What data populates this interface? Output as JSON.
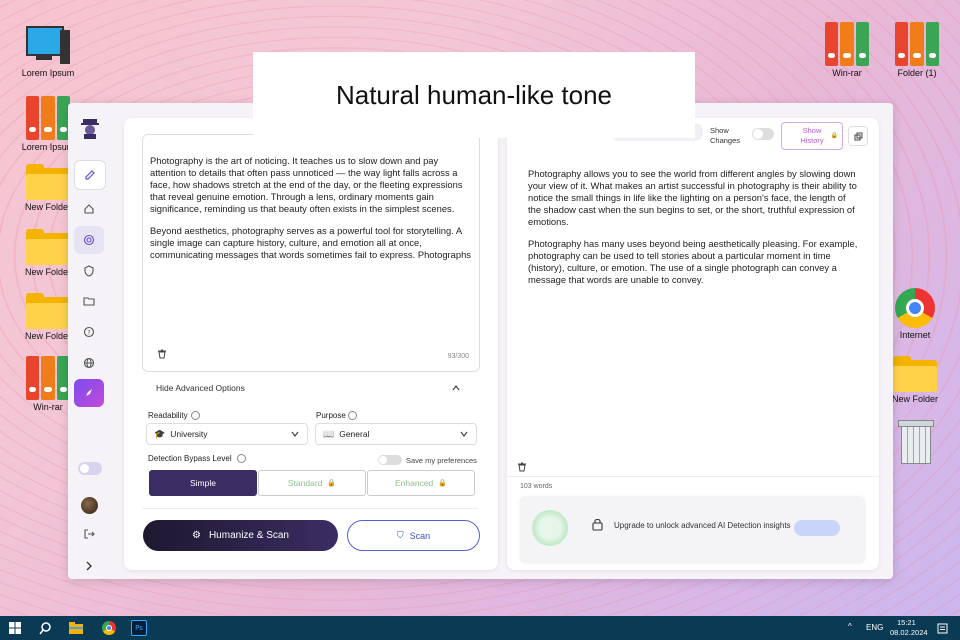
{
  "desktop": {
    "icons_left": [
      {
        "label": "Lorem Ipsum",
        "type": "computer"
      },
      {
        "label": "Lorem Ipsum",
        "type": "binders"
      },
      {
        "label": "New Folder",
        "type": "folder"
      },
      {
        "label": "New Folder",
        "type": "folder"
      },
      {
        "label": "New Folder",
        "type": "folder"
      },
      {
        "label": "Win-rar",
        "type": "binders"
      }
    ],
    "icons_right_top": [
      {
        "label": "Win-rar",
        "type": "binders"
      },
      {
        "label": "Folder (1)",
        "type": "binders"
      }
    ],
    "icons_right": [
      {
        "label": "Internet",
        "type": "chrome"
      },
      {
        "label": "New Folder",
        "type": "folder"
      },
      {
        "label": "",
        "type": "trash"
      }
    ]
  },
  "banner": {
    "text": "Natural human-like tone"
  },
  "input": {
    "paragraph1": "Photography is the art of noticing. It teaches us to slow down and pay attention to details that often pass unnoticed — the way light falls across a face, how shadows stretch at the end of the day, or the fleeting expressions that reveal genuine emotion. Through a lens, ordinary moments gain significance, reminding us that beauty often exists in the simplest scenes.",
    "paragraph2": "Beyond aesthetics, photography serves as a powerful tool for storytelling. A single image can capture history, culture, and emotion all at once, communicating messages that words sometimes fail to express. Photographs",
    "word_count": "93/300"
  },
  "advanced": {
    "toggle_label": "Hide Advanced Options",
    "readability_label": "Readability",
    "readability_value": "University",
    "purpose_label": "Purpose",
    "purpose_value": "General",
    "bypass_label": "Detection Bypass Level",
    "save_pref_label": "Save my preferences",
    "levels": [
      "Simple",
      "Standard",
      "Enhanced"
    ]
  },
  "actions": {
    "humanize_label": "Humanize & Scan",
    "scan_label": "Scan"
  },
  "output": {
    "show_changes_label": "Show Changes",
    "show_history_label": "Show History",
    "paragraph1": "Photography allows you to see the world from different angles by slowing down your view of it. What makes an artist successful in photography is their ability to notice the small things in life like the lighting on a person's face, the length of the shadow cast when the sun begins to set, or the short, truthful expression of emotions.",
    "paragraph2": "Photography has many uses beyond being aesthetically pleasing. For example, photography can be used to tell stories about a particular moment in time (history), culture, or emotion. The use of a single photograph can convey a message that words are unable to convey.",
    "word_count": "103 words",
    "upgrade_text": "Upgrade to unlock advanced AI Detection insights"
  },
  "taskbar": {
    "language": "ENG",
    "time": "15:21",
    "date": "08.02.2024"
  },
  "colors": {
    "accent": "#2e2352",
    "scan_border": "#4b63d8",
    "simple_bg": "#3b2d63"
  }
}
